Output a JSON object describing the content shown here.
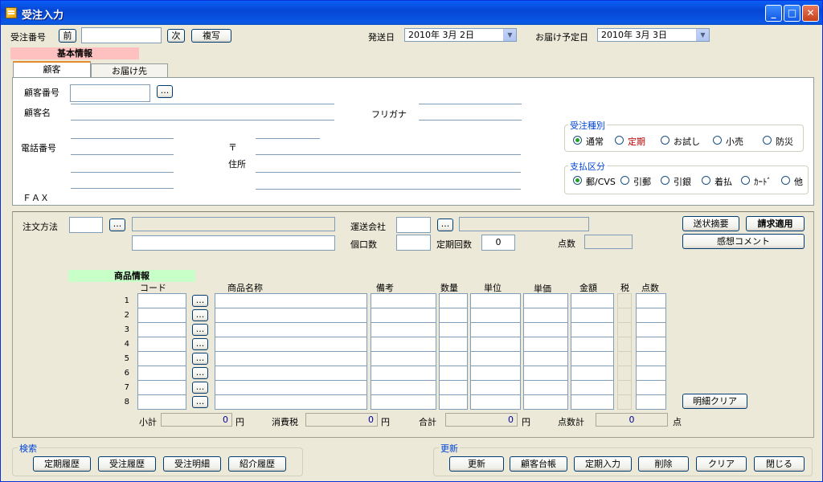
{
  "window": {
    "title": "受注入力"
  },
  "header": {
    "order_no_label": "受注番号",
    "prev": "前",
    "next": "次",
    "copy": "複写",
    "ship_date_label": "発送日",
    "ship_date": "2010年 3月 2日",
    "delivery_date_label": "お届け予定日",
    "delivery_date": "2010年 3月 3日"
  },
  "basic_info_heading": "基本情報",
  "tabs": [
    "顧客",
    "お届け先"
  ],
  "customer": {
    "no_label": "顧客番号",
    "name_label": "顧客名",
    "kana_label": "フリガナ",
    "phone_label": "電話番号",
    "postal_label": "〒",
    "address_label": "住所",
    "fax_label": "ＦＡＸ",
    "ellipsis": "..."
  },
  "order_type": {
    "legend": "受注種別",
    "options": [
      "通常",
      "定期",
      "お試し",
      "小売",
      "防災"
    ],
    "option_colors": [
      "#000000",
      "#c00000",
      "#000000",
      "#000000",
      "#000000"
    ]
  },
  "payment": {
    "legend": "支払区分",
    "options": [
      "郵/CVS",
      "引郵",
      "引銀",
      "着払",
      "ｶｰﾄﾞ",
      "他"
    ]
  },
  "order": {
    "method_label": "注文方法",
    "carrier_label": "運送会社",
    "pieces_label": "個口数",
    "periodic_count_label": "定期回数",
    "periodic_count": "0",
    "points_label": "点数",
    "invoice_summary": "送状摘要",
    "apply_invoice": "請求適用",
    "comment": "感想コメント"
  },
  "products": {
    "heading": "商品情報",
    "columns": [
      "コード",
      "商品名称",
      "備考",
      "数量",
      "単位",
      "単価",
      "金額",
      "税",
      "点数"
    ],
    "rows": [
      "1",
      "2",
      "3",
      "4",
      "5",
      "6",
      "7",
      "8"
    ],
    "ellipsis": "...",
    "clear_detail": "明細クリア"
  },
  "totals": {
    "subtotal_label": "小計",
    "subtotal": "0",
    "yen": "円",
    "tax_label": "消費税",
    "tax": "0",
    "total_label": "合計",
    "total": "0",
    "points_total_label": "点数計",
    "points_total": "0",
    "points_unit": "点"
  },
  "search": {
    "legend": "検索",
    "buttons": [
      "定期履歴",
      "受注履歴",
      "受注明細",
      "紹介履歴"
    ]
  },
  "update": {
    "legend": "更新",
    "buttons": [
      "更新",
      "顧客台帳",
      "定期入力",
      "削除",
      "クリア",
      "閉じる"
    ]
  }
}
